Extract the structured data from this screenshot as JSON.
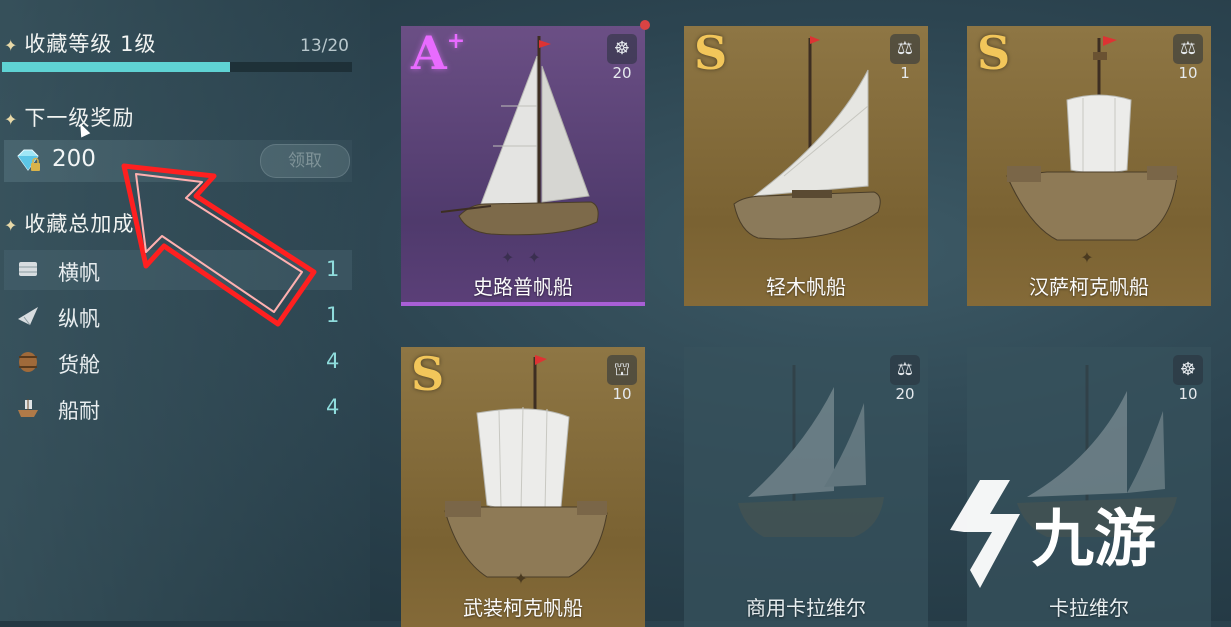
{
  "collection": {
    "title": "收藏等级 1级",
    "progress_text": "13/20",
    "progress_fraction": 0.65
  },
  "next_reward": {
    "title": "下一级奖励",
    "amount": "200",
    "claim_label": "领取"
  },
  "total_bonus": {
    "title": "收藏总加成",
    "items": [
      {
        "icon": "square-sail-icon",
        "name": "横帆",
        "value": "1"
      },
      {
        "icon": "fore-aft-sail-icon",
        "name": "纵帆",
        "value": "1"
      },
      {
        "icon": "cargo-barrel-icon",
        "name": "货舱",
        "value": "4"
      },
      {
        "icon": "hull-ship-icon",
        "name": "船耐",
        "value": "4"
      }
    ]
  },
  "ships": [
    {
      "grade": "A",
      "grade_plus": "+",
      "role_icon": "helm-wheel-icon",
      "role_glyph": "☸",
      "count": "20",
      "name": "史路普帆船",
      "stars": "✦ ✦"
    },
    {
      "grade": "S",
      "grade_plus": "",
      "role_icon": "scales-icon",
      "role_glyph": "⚖",
      "count": "1",
      "name": "轻木帆船",
      "stars": ""
    },
    {
      "grade": "S",
      "grade_plus": "",
      "role_icon": "scales-icon",
      "role_glyph": "⚖",
      "count": "10",
      "name": "汉萨柯克帆船",
      "stars": "✦"
    },
    {
      "grade": "S",
      "grade_plus": "",
      "role_icon": "cannon-icon",
      "role_glyph": "⛫",
      "count": "10",
      "name": "武装柯克帆船",
      "stars": "✦"
    },
    {
      "grade": "",
      "grade_plus": "",
      "role_icon": "scales-icon",
      "role_glyph": "⚖",
      "count": "20",
      "name": "商用卡拉维尔",
      "stars": ""
    },
    {
      "grade": "",
      "grade_plus": "",
      "role_icon": "helm-wheel-icon",
      "role_glyph": "☸",
      "count": "10",
      "name": "卡拉维尔",
      "stars": ""
    }
  ],
  "logo_text": "九游",
  "colors": {
    "accent": "#5fd3d4",
    "gold_card": "#8e7644",
    "purple_card": "#6b4f85",
    "arrow": "#ff2a2a"
  }
}
